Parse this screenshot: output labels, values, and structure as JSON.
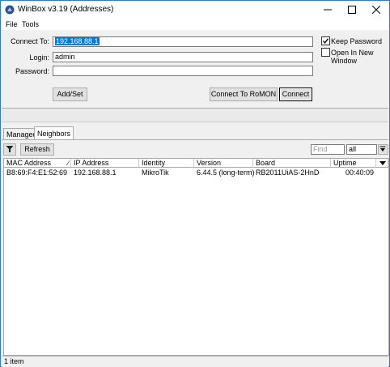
{
  "window": {
    "title": "WinBox v3.19 (Addresses)"
  },
  "menu": {
    "items": [
      "File",
      "Tools"
    ]
  },
  "login_form": {
    "connect_to_label": "Connect To:",
    "connect_to_value": "192.168.88.1",
    "login_label": "Login:",
    "login_value": "admin",
    "password_label": "Password:",
    "password_value": "",
    "keep_password_label": "Keep Password",
    "keep_password_checked": true,
    "open_new_window_label": "Open In New Window",
    "open_new_window_checked": false,
    "add_set_label": "Add/Set",
    "connect_romon_label": "Connect To RoMON",
    "connect_label": "Connect"
  },
  "tabs": [
    {
      "label": "Managed",
      "active": false
    },
    {
      "label": "Neighbors",
      "active": true
    }
  ],
  "toolbar": {
    "refresh_label": "Refresh",
    "find_placeholder": "Find",
    "filter_value": "all"
  },
  "table": {
    "columns": [
      "MAC Address",
      "IP Address",
      "Identity",
      "Version",
      "Board",
      "Uptime"
    ],
    "rows": [
      [
        "B8:69:F4:E1:52:69",
        "192.168.88.1",
        "MikroTik",
        "6.44.5 (long-term)",
        "RB2011UiAS-2HnD",
        "00:40:09"
      ]
    ]
  },
  "status": {
    "count_text": "1 item"
  },
  "colors": {
    "selection": "#0078d7",
    "window_border": "#2b79d0"
  }
}
